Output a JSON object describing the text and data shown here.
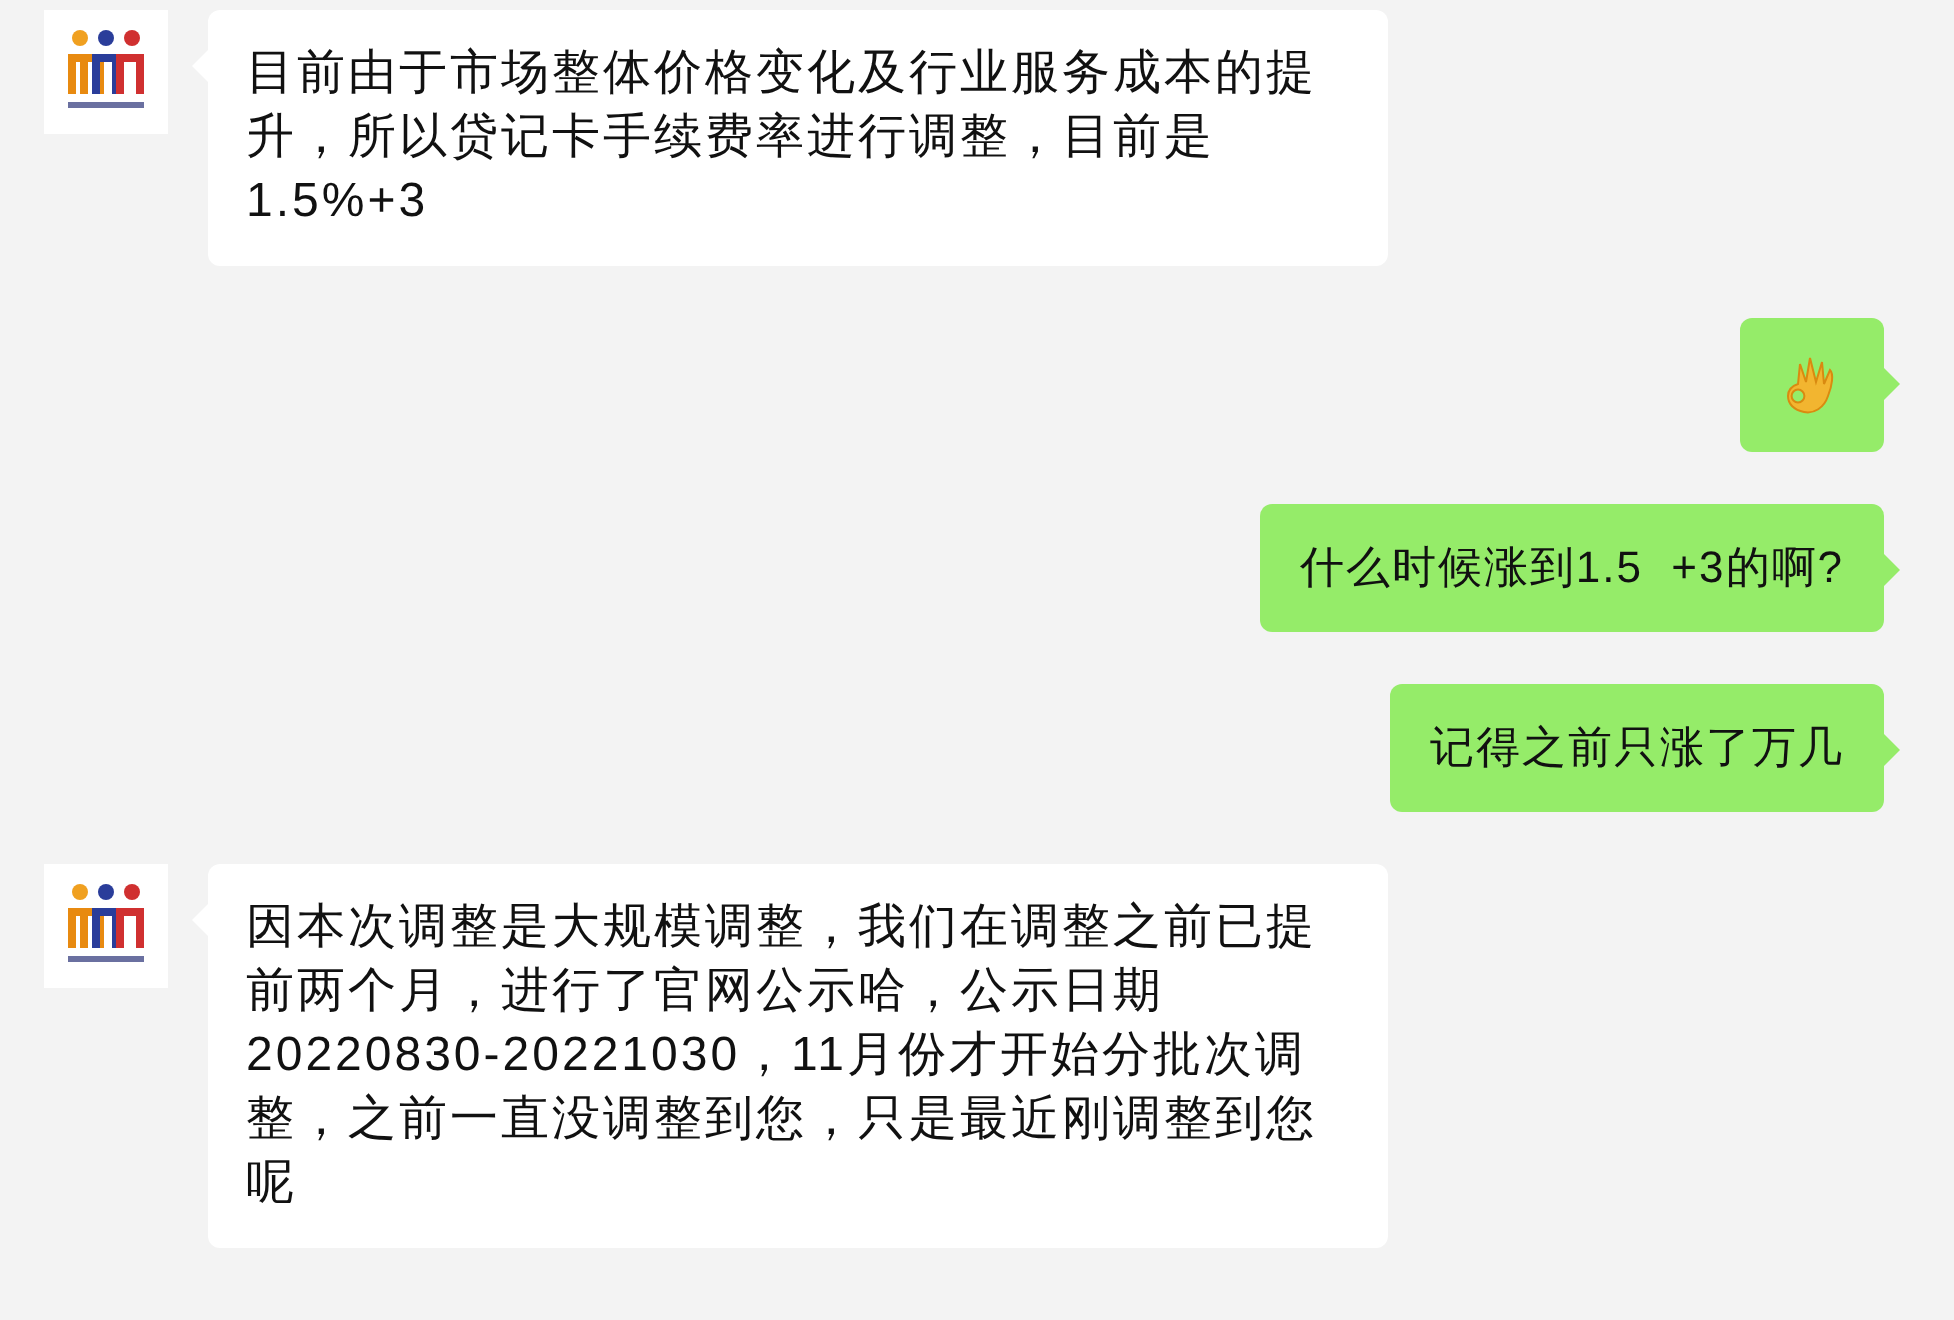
{
  "messages": [
    {
      "outgoing": false,
      "kind": "text",
      "text": "目前由于市场整体价格变化及行业服务成本的提升，所以贷记卡手续费率进行调整，目前是1.5%+3"
    },
    {
      "outgoing": true,
      "kind": "emoji"
    },
    {
      "outgoing": true,
      "kind": "text",
      "text": "什么时候涨到1.5  +3的啊?"
    },
    {
      "outgoing": true,
      "kind": "text",
      "text": "记得之前只涨了万几"
    },
    {
      "outgoing": false,
      "kind": "text",
      "text": "因本次调整是大规模调整，我们在调整之前已提前两个月，进行了官网公示哈，公示日期20220830-20221030，11月份才开始分批次调整，之前一直没调整到您，只是最近刚调整到您呢"
    }
  ]
}
